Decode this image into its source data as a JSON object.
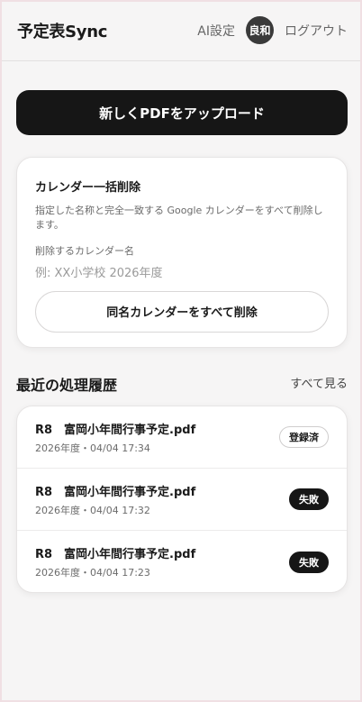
{
  "header": {
    "app_title": "予定表Sync",
    "ai_settings_label": "AI設定",
    "avatar_text": "良和",
    "logout_label": "ログアウト"
  },
  "upload": {
    "button_label": "新しくPDFをアップロード"
  },
  "bulk_delete": {
    "title": "カレンダー一括削除",
    "description": "指定した名称と完全一致する Google カレンダーをすべて削除します。",
    "field_label": "削除するカレンダー名",
    "input_value": "",
    "input_placeholder": "例: XX小学校 2026年度",
    "button_label": "同名カレンダーをすべて削除"
  },
  "history": {
    "title": "最近の処理履歴",
    "see_all_label": "すべて見る",
    "items": [
      {
        "title": "R8　富岡小年間行事予定.pdf",
        "meta": "2026年度・04/04 17:34",
        "status": "登録済"
      },
      {
        "title": "R8　富岡小年間行事予定.pdf",
        "meta": "2026年度・04/04 17:32",
        "status": "失敗"
      },
      {
        "title": "R8　富岡小年間行事予定.pdf",
        "meta": "2026年度・04/04 17:23",
        "status": "失敗"
      }
    ]
  },
  "colors": {
    "primary": "#161616",
    "background": "#f6f5f5",
    "card": "#ffffff"
  }
}
